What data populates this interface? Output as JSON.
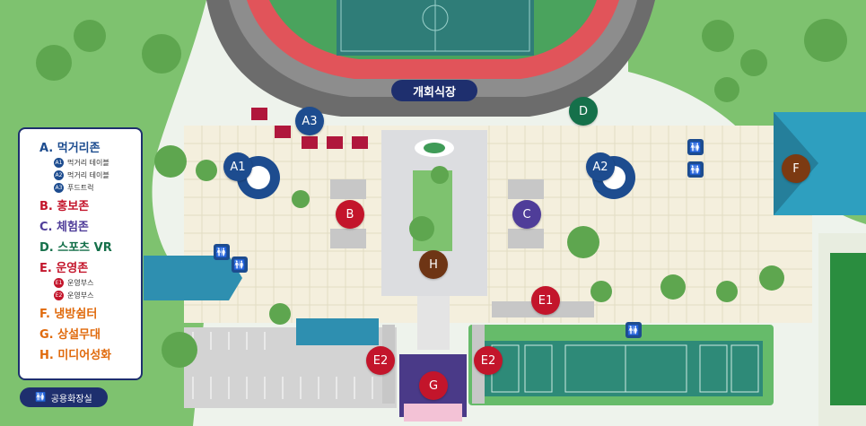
{
  "stadium": {
    "label": "개회식장"
  },
  "markers": [
    {
      "id": "A1",
      "label": "A1",
      "color": "#1d4c8f"
    },
    {
      "id": "A2",
      "label": "A2",
      "color": "#1d4c8f"
    },
    {
      "id": "A3",
      "label": "A3",
      "color": "#1d4c8f"
    },
    {
      "id": "B",
      "label": "B",
      "color": "#c3152b"
    },
    {
      "id": "C",
      "label": "C",
      "color": "#4f3d99"
    },
    {
      "id": "D",
      "label": "D",
      "color": "#15704a"
    },
    {
      "id": "E1",
      "label": "E1",
      "color": "#c3152b"
    },
    {
      "id": "E2a",
      "label": "E2",
      "color": "#c3152b"
    },
    {
      "id": "E2b",
      "label": "E2",
      "color": "#c3152b"
    },
    {
      "id": "F",
      "label": "F",
      "color": "#7c3a12"
    },
    {
      "id": "G",
      "label": "G",
      "color": "#c3152b"
    },
    {
      "id": "H",
      "label": "H",
      "color": "#6e3515"
    }
  ],
  "legend": {
    "items": [
      {
        "label": "A. 먹거리존",
        "color": "#1d4c8f",
        "subs": [
          {
            "badge": "A1",
            "label": "먹거리 테이블"
          },
          {
            "badge": "A2",
            "label": "먹거리 테이블"
          },
          {
            "badge": "A3",
            "label": "푸드트럭"
          }
        ]
      },
      {
        "label": "B. 홍보존",
        "color": "#c3152b",
        "subs": []
      },
      {
        "label": "C. 체험존",
        "color": "#4f3d99",
        "subs": []
      },
      {
        "label": "D. 스포츠 VR",
        "color": "#15704a",
        "subs": []
      },
      {
        "label": "E. 운영존",
        "color": "#c3152b",
        "subs": [
          {
            "badge": "E1",
            "label": "운영부스"
          },
          {
            "badge": "E2",
            "label": "운영부스"
          }
        ]
      },
      {
        "label": "F.  냉방쉼터",
        "color": "#e06a0c",
        "subs": []
      },
      {
        "label": "G. 상설무대",
        "color": "#e06a0c",
        "subs": []
      },
      {
        "label": "H. 미디어성화",
        "color": "#e06a0c",
        "subs": []
      }
    ]
  },
  "restroom_legend": {
    "label": "공용화장실",
    "icon": "restroom-icon"
  },
  "restroom_icon_glyph": "🚻"
}
